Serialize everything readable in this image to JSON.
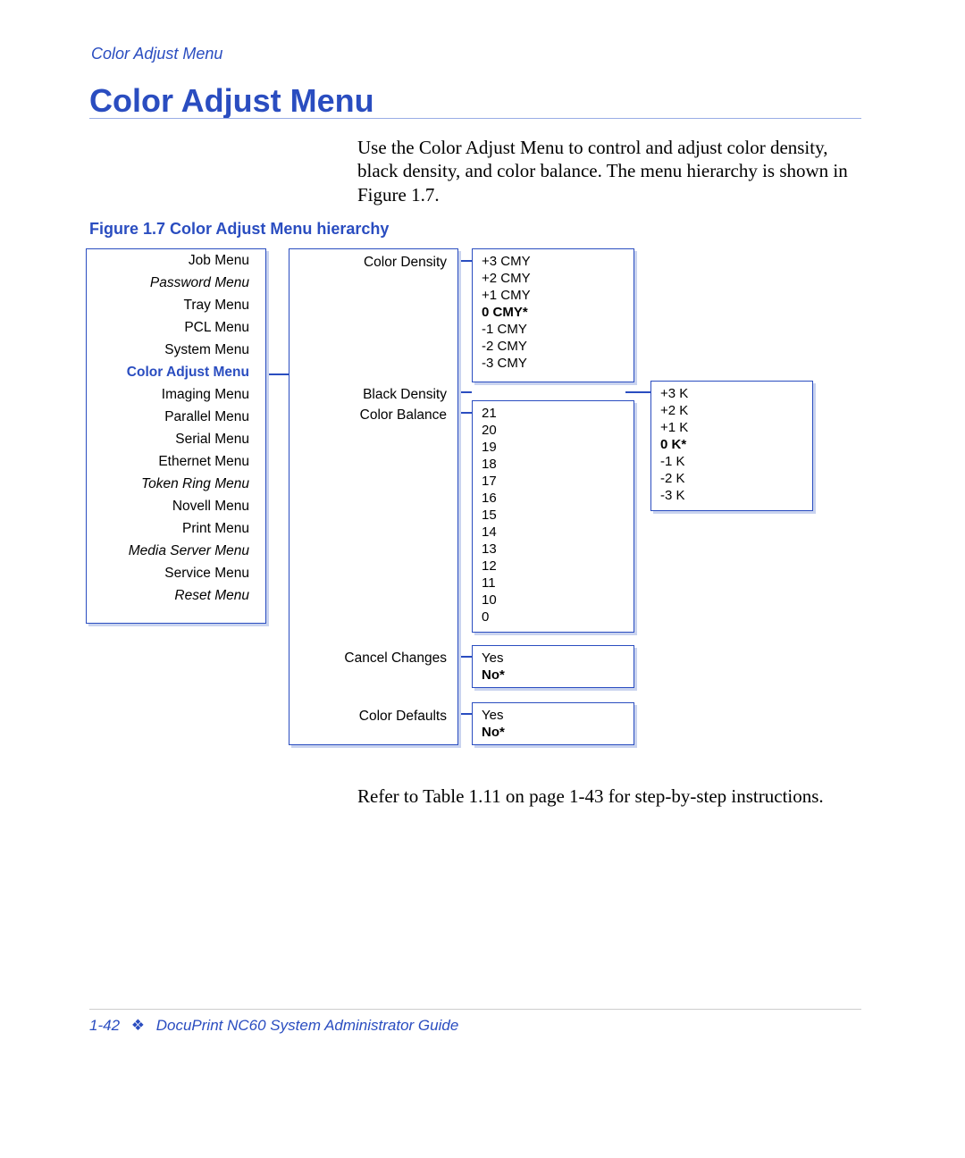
{
  "header": {
    "running_head": "Color Adjust Menu"
  },
  "title": "Color Adjust Menu",
  "intro": "Use the Color Adjust Menu to control and adjust color density, black density, and color balance. The menu hierarchy is shown in Figure 1.7.",
  "figure_caption": "Figure 1.7   Color Adjust Menu hierarchy",
  "menu_items": [
    {
      "label": "Job Menu",
      "italic": false,
      "selected": false
    },
    {
      "label": "Password Menu",
      "italic": true,
      "selected": false
    },
    {
      "label": "Tray Menu",
      "italic": false,
      "selected": false
    },
    {
      "label": "PCL Menu",
      "italic": false,
      "selected": false
    },
    {
      "label": "System Menu",
      "italic": false,
      "selected": false
    },
    {
      "label": "Color Adjust Menu",
      "italic": false,
      "selected": true
    },
    {
      "label": "Imaging Menu",
      "italic": false,
      "selected": false
    },
    {
      "label": "Parallel Menu",
      "italic": false,
      "selected": false
    },
    {
      "label": "Serial Menu",
      "italic": false,
      "selected": false
    },
    {
      "label": "Ethernet Menu",
      "italic": false,
      "selected": false
    },
    {
      "label": "Token Ring Menu",
      "italic": true,
      "selected": false
    },
    {
      "label": "Novell Menu",
      "italic": false,
      "selected": false
    },
    {
      "label": "Print Menu",
      "italic": false,
      "selected": false
    },
    {
      "label": "Media Server Menu",
      "italic": true,
      "selected": false
    },
    {
      "label": "Service Menu",
      "italic": false,
      "selected": false
    },
    {
      "label": "Reset Menu",
      "italic": true,
      "selected": false
    }
  ],
  "submenu_items": [
    {
      "label": "Color Density"
    },
    {
      "label": "Black Density"
    },
    {
      "label": "Color Balance"
    },
    {
      "label": "Cancel Changes"
    },
    {
      "label": "Color Defaults"
    }
  ],
  "cmy_options": [
    {
      "label": "+3 CMY",
      "default": false
    },
    {
      "label": "+2 CMY",
      "default": false
    },
    {
      "label": "+1 CMY",
      "default": false
    },
    {
      "label": "0 CMY*",
      "default": true
    },
    {
      "label": "-1 CMY",
      "default": false
    },
    {
      "label": "-2 CMY",
      "default": false
    },
    {
      "label": "-3 CMY",
      "default": false
    }
  ],
  "k_options": [
    {
      "label": "+3 K",
      "default": false
    },
    {
      "label": "+2 K",
      "default": false
    },
    {
      "label": "+1 K",
      "default": false
    },
    {
      "label": "0 K*",
      "default": true
    },
    {
      "label": "-1 K",
      "default": false
    },
    {
      "label": "-2 K",
      "default": false
    },
    {
      "label": "-3 K",
      "default": false
    }
  ],
  "balance_options": [
    {
      "label": "21"
    },
    {
      "label": "20"
    },
    {
      "label": "19"
    },
    {
      "label": "18"
    },
    {
      "label": "17"
    },
    {
      "label": "16"
    },
    {
      "label": "15"
    },
    {
      "label": "14"
    },
    {
      "label": "13"
    },
    {
      "label": "12"
    },
    {
      "label": "11"
    },
    {
      "label": "10"
    },
    {
      "label": "0"
    }
  ],
  "cancel_options": [
    {
      "label": "Yes",
      "default": false
    },
    {
      "label": "No*",
      "default": true
    }
  ],
  "defaults_options": [
    {
      "label": "Yes",
      "default": false
    },
    {
      "label": "No*",
      "default": true
    }
  ],
  "outro": "Refer to Table 1.11 on page 1-43 for step-by-step instructions.",
  "footer": {
    "page_number": "1-42",
    "doc_title": "DocuPrint NC60 System Administrator Guide"
  }
}
